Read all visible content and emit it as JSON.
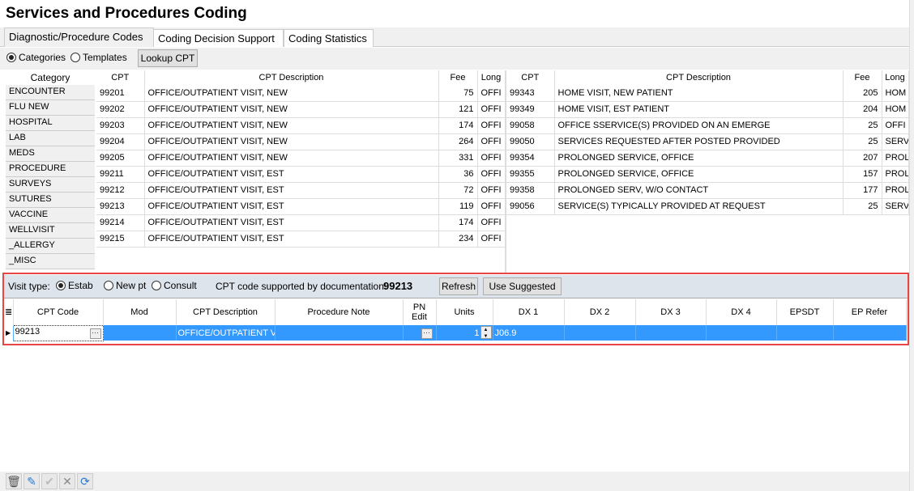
{
  "title": "Services and Procedures Coding",
  "tabs": [
    "Diagnostic/Procedure Codes",
    "Coding Decision Support",
    "Coding Statistics"
  ],
  "toolbar": {
    "categories": "Categories",
    "templates": "Templates",
    "lookup": "Lookup CPT",
    "mode": "Categories"
  },
  "categories": {
    "header": "Category",
    "items": [
      "ENCOUNTER",
      "FLU NEW",
      "HOSPITAL",
      "LAB",
      "MEDS",
      "PROCEDURE",
      "SURVEYS",
      "SUTURES",
      "VACCINE",
      "WELLVISIT",
      "_ALLERGY",
      "_MISC"
    ]
  },
  "left_table": {
    "headers": [
      "CPT",
      "CPT Description",
      "Fee",
      "Long"
    ],
    "rows": [
      [
        "99201",
        "OFFICE/OUTPATIENT VISIT, NEW",
        "75",
        "OFFI"
      ],
      [
        "99202",
        "OFFICE/OUTPATIENT VISIT, NEW",
        "121",
        "OFFI"
      ],
      [
        "99203",
        "OFFICE/OUTPATIENT VISIT, NEW",
        "174",
        "OFFI"
      ],
      [
        "99204",
        "OFFICE/OUTPATIENT VISIT, NEW",
        "264",
        "OFFI"
      ],
      [
        "99205",
        "OFFICE/OUTPATIENT VISIT, NEW",
        "331",
        "OFFI"
      ],
      [
        "99211",
        "OFFICE/OUTPATIENT VISIT, EST",
        "36",
        "OFFI"
      ],
      [
        "99212",
        "OFFICE/OUTPATIENT VISIT, EST",
        "72",
        "OFFI"
      ],
      [
        "99213",
        "OFFICE/OUTPATIENT VISIT, EST",
        "119",
        "OFFI"
      ],
      [
        "99214",
        "OFFICE/OUTPATIENT VISIT, EST",
        "174",
        "OFFI"
      ],
      [
        "99215",
        "OFFICE/OUTPATIENT VISIT, EST",
        "234",
        "OFFI"
      ]
    ]
  },
  "right_table": {
    "headers": [
      "CPT",
      "CPT Description",
      "Fee",
      "Long"
    ],
    "rows": [
      [
        "99343",
        "HOME VISIT, NEW PATIENT",
        "205",
        "HOM"
      ],
      [
        "99349",
        "HOME VISIT, EST PATIENT",
        "204",
        "HOM"
      ],
      [
        "99058",
        "OFFICE SSERVICE(S) PROVIDED ON AN EMERGE",
        "25",
        "OFFI"
      ],
      [
        "99050",
        "SERVICES REQUESTED AFTER POSTED PROVIDED",
        "25",
        "SERV"
      ],
      [
        "99354",
        "PROLONGED SERVICE, OFFICE",
        "207",
        "PROL"
      ],
      [
        "99355",
        "PROLONGED SERVICE, OFFICE",
        "157",
        "PROL"
      ],
      [
        "99358",
        "PROLONGED SERV, W/O CONTACT",
        "177",
        "PROL"
      ],
      [
        "99056",
        "SERVICE(S) TYPICALLY PROVIDED AT REQUEST",
        "25",
        "SERV"
      ]
    ]
  },
  "visit": {
    "label": "Visit type:",
    "options": [
      "Estab",
      "New pt",
      "Consult"
    ],
    "selected": "Estab",
    "supported_label": "CPT code supported by documentation:",
    "supported_code": "99213",
    "refresh": "Refresh",
    "use_suggested": "Use Suggested"
  },
  "grid": {
    "headers": [
      "CPT Code",
      "Mod",
      "CPT Description",
      "Procedure Note",
      "PN Edit",
      "Units",
      "DX 1",
      "DX 2",
      "DX 3",
      "DX 4",
      "EPSDT",
      "EP Refer"
    ],
    "row": {
      "cpt": "99213",
      "mod": "",
      "desc": "OFFICE/OUTPATIENT VI",
      "note": "",
      "units": "1",
      "dx1": "J06.9",
      "dx2": "",
      "dx3": "",
      "dx4": "",
      "epsdt": "",
      "eprefer": ""
    }
  },
  "bottom_toolbar": [
    "trash-icon",
    "pencil-icon",
    "check-icon",
    "x-icon",
    "refresh-icon"
  ],
  "colors": {
    "selection": "#3399ff",
    "highlight_border": "#e84545"
  }
}
